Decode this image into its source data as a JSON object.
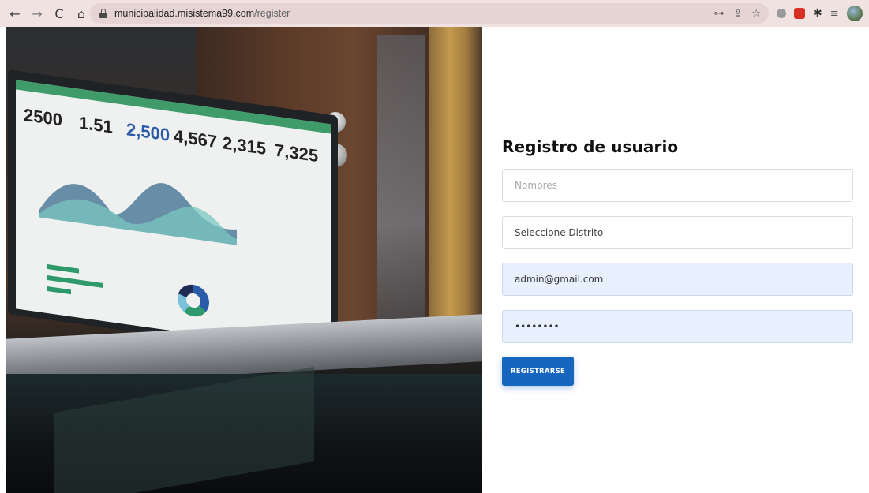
{
  "browser": {
    "back_icon": "←",
    "forward_icon": "→",
    "reload_icon": "C",
    "home_icon": "⌂",
    "url_domain": "municipalidad.misistema99.com",
    "url_path": "/register",
    "key_icon": "⊶",
    "share_icon": "⇪",
    "star_icon": "☆",
    "puzzle_icon": "✱",
    "reading_list_icon": "≡",
    "menu_icon": "⋮"
  },
  "hero": {
    "kpis": [
      "2500",
      "1.51",
      "2,500",
      "4,567",
      "2,315",
      "7,325"
    ]
  },
  "form": {
    "title": "Registro de usuario",
    "name_placeholder": "Nombres",
    "district_label": "Seleccione Distrito",
    "email_value": "admin@gmail.com",
    "password_value": "password",
    "submit_label": "REGISTRARSE"
  },
  "colors": {
    "accent": "#1666c0",
    "autofill_bg": "#e8f0fe",
    "chrome_bg": "#f1e2e2"
  }
}
